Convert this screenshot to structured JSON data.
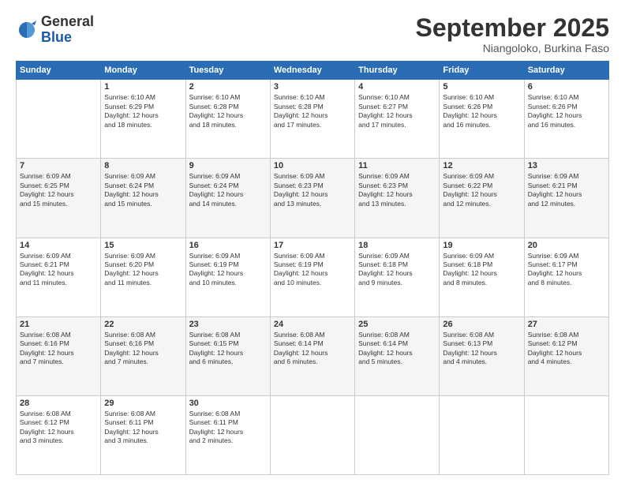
{
  "logo": {
    "line1": "General",
    "line2": "Blue"
  },
  "title": "September 2025",
  "subtitle": "Niangoloko, Burkina Faso",
  "weekdays": [
    "Sunday",
    "Monday",
    "Tuesday",
    "Wednesday",
    "Thursday",
    "Friday",
    "Saturday"
  ],
  "weeks": [
    [
      {
        "day": "",
        "info": ""
      },
      {
        "day": "1",
        "info": "Sunrise: 6:10 AM\nSunset: 6:29 PM\nDaylight: 12 hours\nand 18 minutes."
      },
      {
        "day": "2",
        "info": "Sunrise: 6:10 AM\nSunset: 6:28 PM\nDaylight: 12 hours\nand 18 minutes."
      },
      {
        "day": "3",
        "info": "Sunrise: 6:10 AM\nSunset: 6:28 PM\nDaylight: 12 hours\nand 17 minutes."
      },
      {
        "day": "4",
        "info": "Sunrise: 6:10 AM\nSunset: 6:27 PM\nDaylight: 12 hours\nand 17 minutes."
      },
      {
        "day": "5",
        "info": "Sunrise: 6:10 AM\nSunset: 6:26 PM\nDaylight: 12 hours\nand 16 minutes."
      },
      {
        "day": "6",
        "info": "Sunrise: 6:10 AM\nSunset: 6:26 PM\nDaylight: 12 hours\nand 16 minutes."
      }
    ],
    [
      {
        "day": "7",
        "info": "Sunrise: 6:09 AM\nSunset: 6:25 PM\nDaylight: 12 hours\nand 15 minutes."
      },
      {
        "day": "8",
        "info": "Sunrise: 6:09 AM\nSunset: 6:24 PM\nDaylight: 12 hours\nand 15 minutes."
      },
      {
        "day": "9",
        "info": "Sunrise: 6:09 AM\nSunset: 6:24 PM\nDaylight: 12 hours\nand 14 minutes."
      },
      {
        "day": "10",
        "info": "Sunrise: 6:09 AM\nSunset: 6:23 PM\nDaylight: 12 hours\nand 13 minutes."
      },
      {
        "day": "11",
        "info": "Sunrise: 6:09 AM\nSunset: 6:23 PM\nDaylight: 12 hours\nand 13 minutes."
      },
      {
        "day": "12",
        "info": "Sunrise: 6:09 AM\nSunset: 6:22 PM\nDaylight: 12 hours\nand 12 minutes."
      },
      {
        "day": "13",
        "info": "Sunrise: 6:09 AM\nSunset: 6:21 PM\nDaylight: 12 hours\nand 12 minutes."
      }
    ],
    [
      {
        "day": "14",
        "info": "Sunrise: 6:09 AM\nSunset: 6:21 PM\nDaylight: 12 hours\nand 11 minutes."
      },
      {
        "day": "15",
        "info": "Sunrise: 6:09 AM\nSunset: 6:20 PM\nDaylight: 12 hours\nand 11 minutes."
      },
      {
        "day": "16",
        "info": "Sunrise: 6:09 AM\nSunset: 6:19 PM\nDaylight: 12 hours\nand 10 minutes."
      },
      {
        "day": "17",
        "info": "Sunrise: 6:09 AM\nSunset: 6:19 PM\nDaylight: 12 hours\nand 10 minutes."
      },
      {
        "day": "18",
        "info": "Sunrise: 6:09 AM\nSunset: 6:18 PM\nDaylight: 12 hours\nand 9 minutes."
      },
      {
        "day": "19",
        "info": "Sunrise: 6:09 AM\nSunset: 6:18 PM\nDaylight: 12 hours\nand 8 minutes."
      },
      {
        "day": "20",
        "info": "Sunrise: 6:09 AM\nSunset: 6:17 PM\nDaylight: 12 hours\nand 8 minutes."
      }
    ],
    [
      {
        "day": "21",
        "info": "Sunrise: 6:08 AM\nSunset: 6:16 PM\nDaylight: 12 hours\nand 7 minutes."
      },
      {
        "day": "22",
        "info": "Sunrise: 6:08 AM\nSunset: 6:16 PM\nDaylight: 12 hours\nand 7 minutes."
      },
      {
        "day": "23",
        "info": "Sunrise: 6:08 AM\nSunset: 6:15 PM\nDaylight: 12 hours\nand 6 minutes."
      },
      {
        "day": "24",
        "info": "Sunrise: 6:08 AM\nSunset: 6:14 PM\nDaylight: 12 hours\nand 6 minutes."
      },
      {
        "day": "25",
        "info": "Sunrise: 6:08 AM\nSunset: 6:14 PM\nDaylight: 12 hours\nand 5 minutes."
      },
      {
        "day": "26",
        "info": "Sunrise: 6:08 AM\nSunset: 6:13 PM\nDaylight: 12 hours\nand 4 minutes."
      },
      {
        "day": "27",
        "info": "Sunrise: 6:08 AM\nSunset: 6:12 PM\nDaylight: 12 hours\nand 4 minutes."
      }
    ],
    [
      {
        "day": "28",
        "info": "Sunrise: 6:08 AM\nSunset: 6:12 PM\nDaylight: 12 hours\nand 3 minutes."
      },
      {
        "day": "29",
        "info": "Sunrise: 6:08 AM\nSunset: 6:11 PM\nDaylight: 12 hours\nand 3 minutes."
      },
      {
        "day": "30",
        "info": "Sunrise: 6:08 AM\nSunset: 6:11 PM\nDaylight: 12 hours\nand 2 minutes."
      },
      {
        "day": "",
        "info": ""
      },
      {
        "day": "",
        "info": ""
      },
      {
        "day": "",
        "info": ""
      },
      {
        "day": "",
        "info": ""
      }
    ]
  ]
}
